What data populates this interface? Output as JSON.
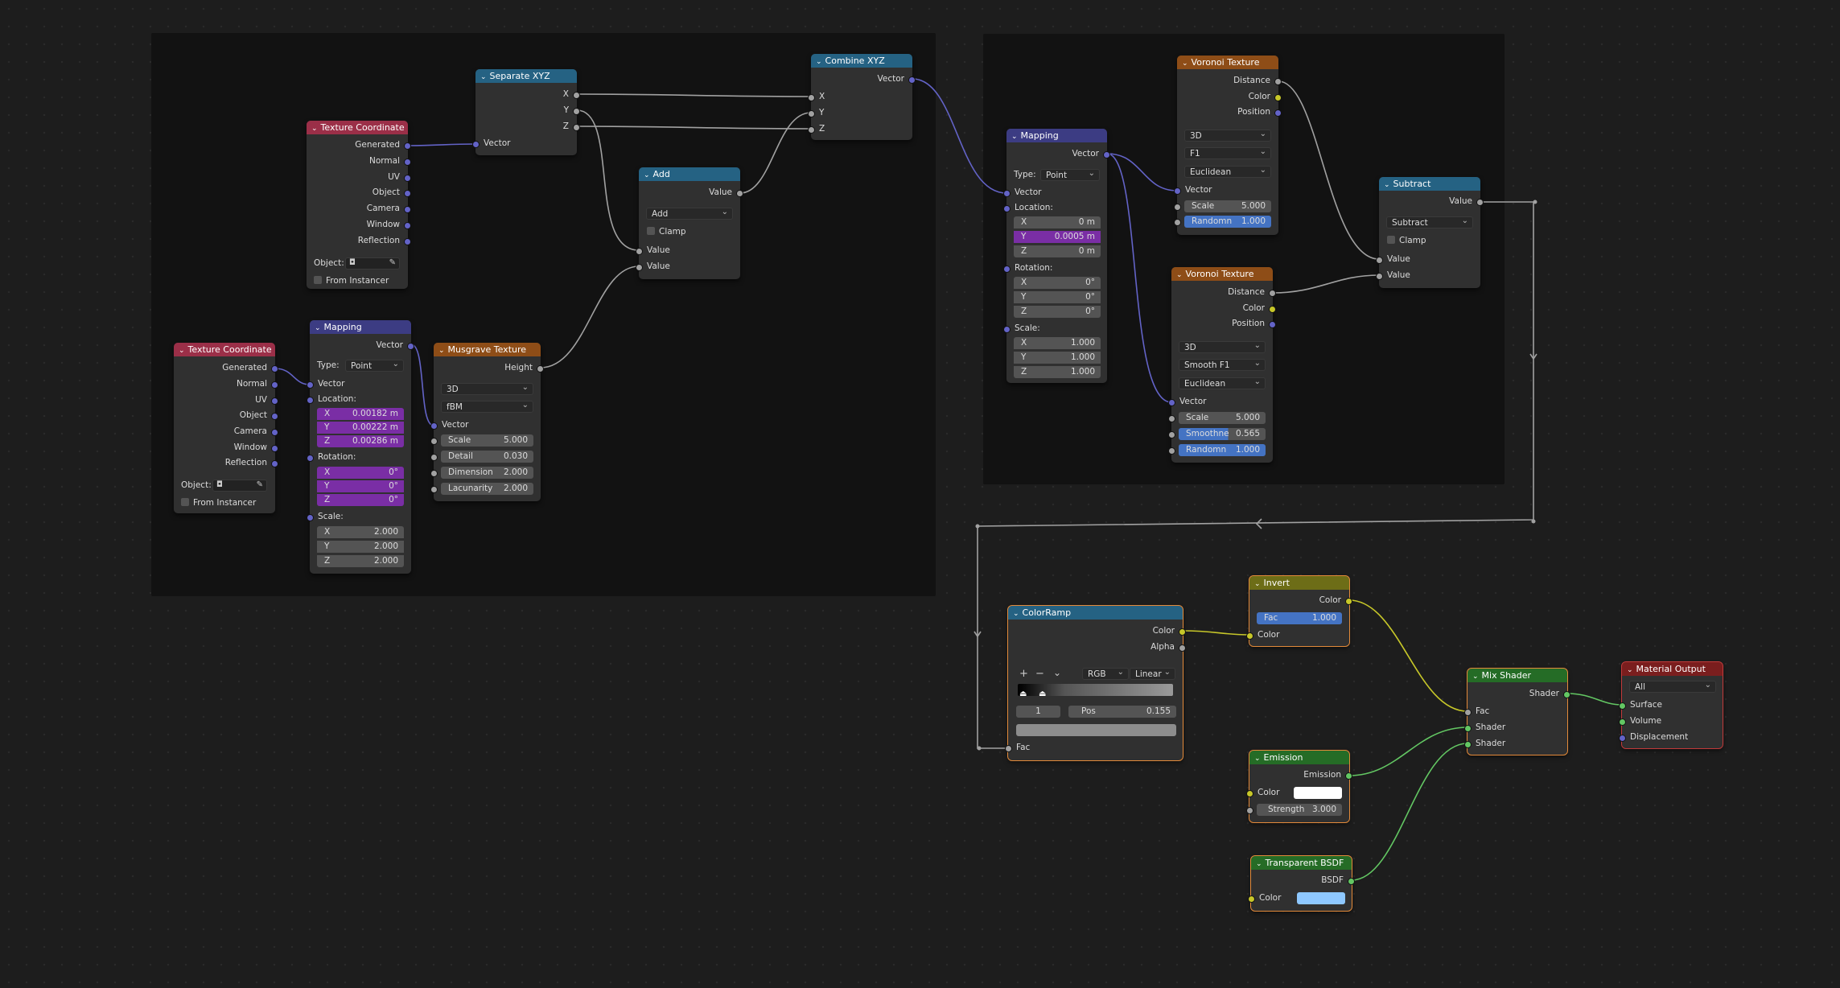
{
  "colors": {
    "vector_socket": "#6363c7",
    "float_socket": "#a1a1a1",
    "color_socket": "#c7c729",
    "shader_socket": "#63c763",
    "input_header": "#9b2f48",
    "vector_header": "#3c3c83",
    "texture_header": "#8e4d17",
    "converter_header": "#256283",
    "color_header": "#6d6d17",
    "shader_header": "#256c26",
    "output_header": "#7a1e1e"
  },
  "nodes": {
    "tc1": {
      "title": "Texture Coordinate",
      "outputs": [
        "Generated",
        "Normal",
        "UV",
        "Object",
        "Camera",
        "Window",
        "Reflection"
      ],
      "object_label": "Object:",
      "from_instancer": "From Instancer"
    },
    "tc2": {
      "title": "Texture Coordinate",
      "outputs": [
        "Generated",
        "Normal",
        "UV",
        "Object",
        "Camera",
        "Window",
        "Reflection"
      ],
      "object_label": "Object:",
      "from_instancer": "From Instancer"
    },
    "sepxyz": {
      "title": "Separate XYZ",
      "outputs": [
        "X",
        "Y",
        "Z"
      ],
      "input": "Vector"
    },
    "combxyz": {
      "title": "Combine XYZ",
      "output": "Vector",
      "inputs": [
        "X",
        "Y",
        "Z"
      ]
    },
    "add": {
      "title": "Add",
      "output": "Value",
      "operation": "Add",
      "clamp": "Clamp",
      "inputs": [
        "Value",
        "Value"
      ]
    },
    "map1": {
      "title": "Mapping",
      "output": "Vector",
      "type_label": "Type:",
      "type_value": "Point",
      "vector": "Vector",
      "location": "Location:",
      "rotation": "Rotation:",
      "scale": "Scale:",
      "loc": [
        [
          "X",
          "0.00182 m"
        ],
        [
          "Y",
          "0.00222 m"
        ],
        [
          "Z",
          "0.00286 m"
        ]
      ],
      "rot": [
        [
          "X",
          "0°"
        ],
        [
          "Y",
          "0°"
        ],
        [
          "Z",
          "0°"
        ]
      ],
      "scl": [
        [
          "X",
          "2.000"
        ],
        [
          "Y",
          "2.000"
        ],
        [
          "Z",
          "2.000"
        ]
      ]
    },
    "musgrave": {
      "title": "Musgrave Texture",
      "output": "Height",
      "dim": "3D",
      "mtype": "fBM",
      "vector": "Vector",
      "fields": [
        [
          "Scale",
          "5.000"
        ],
        [
          "Detail",
          "0.030"
        ],
        [
          "Dimension",
          "2.000"
        ],
        [
          "Lacunarity",
          "2.000"
        ]
      ]
    },
    "map2": {
      "title": "Mapping",
      "output": "Vector",
      "type_label": "Type:",
      "type_value": "Point",
      "vector": "Vector",
      "location": "Location:",
      "rotation": "Rotation:",
      "scale": "Scale:",
      "loc": [
        [
          "X",
          "0 m"
        ],
        [
          "Y",
          "0.0005 m"
        ],
        [
          "Z",
          "0 m"
        ]
      ],
      "rot": [
        [
          "X",
          "0°"
        ],
        [
          "Y",
          "0°"
        ],
        [
          "Z",
          "0°"
        ]
      ],
      "scl": [
        [
          "X",
          "1.000"
        ],
        [
          "Y",
          "1.000"
        ],
        [
          "Z",
          "1.000"
        ]
      ]
    },
    "vor1": {
      "title": "Voronoi Texture",
      "outputs": [
        "Distance",
        "Color",
        "Position"
      ],
      "dim": "3D",
      "feature": "F1",
      "metric": "Euclidean",
      "vector": "Vector",
      "fields": [
        [
          "Scale",
          "5.000"
        ],
        [
          "Randomn",
          "1.000"
        ]
      ]
    },
    "vor2": {
      "title": "Voronoi Texture",
      "outputs": [
        "Distance",
        "Color",
        "Position"
      ],
      "dim": "3D",
      "feature": "Smooth F1",
      "metric": "Euclidean",
      "vector": "Vector",
      "fields": [
        [
          "Scale",
          "5.000"
        ],
        [
          "Smoothne",
          "0.565"
        ],
        [
          "Randomn",
          "1.000"
        ]
      ]
    },
    "subtract": {
      "title": "Subtract",
      "output": "Value",
      "operation": "Subtract",
      "clamp": "Clamp",
      "inputs": [
        "Value",
        "Value"
      ]
    },
    "ramp": {
      "title": "ColorRamp",
      "outputs": [
        "Color",
        "Alpha"
      ],
      "plus": "+",
      "minus": "−",
      "down": "⌄",
      "mode": "RGB",
      "interp": "Linear",
      "index": "1",
      "pos_label": "Pos",
      "pos_value": "0.155",
      "input": "Fac"
    },
    "invert": {
      "title": "Invert",
      "output": "Color",
      "fac_label": "Fac",
      "fac_value": "1.000",
      "input": "Color"
    },
    "emission": {
      "title": "Emission",
      "output": "Emission",
      "color": "Color",
      "strength_label": "Strength",
      "strength_value": "3.000"
    },
    "transparent": {
      "title": "Transparent BSDF",
      "output": "BSDF",
      "color": "Color"
    },
    "mix": {
      "title": "Mix Shader",
      "output": "Shader",
      "inputs": [
        "Fac",
        "Shader",
        "Shader"
      ]
    },
    "output": {
      "title": "Material Output",
      "target": "All",
      "inputs": [
        "Surface",
        "Volume",
        "Displacement"
      ]
    }
  }
}
